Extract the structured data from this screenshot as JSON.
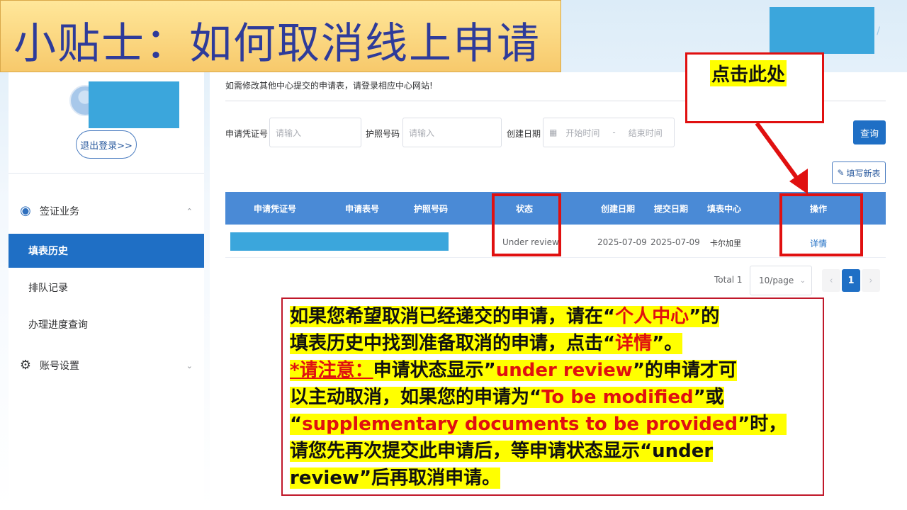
{
  "title": "小贴士：如何取消线上申请",
  "sidebar": {
    "logout_label": "退出登录>>",
    "groups": [
      {
        "label": "签证业务",
        "icon": "globe-icon",
        "expanded": true
      },
      {
        "label": "账号设置",
        "icon": "gear-icon",
        "expanded": false
      }
    ],
    "items": [
      {
        "label": "填表历史",
        "active": true
      },
      {
        "label": "排队记录",
        "active": false
      },
      {
        "label": "办理进度查询",
        "active": false
      }
    ]
  },
  "main": {
    "notice": "如需修改其他中心提交的申请表，请登录相应中心网站!",
    "filters": {
      "voucher_label": "申请凭证号",
      "voucher_placeholder": "请输入",
      "passport_label": "护照号码",
      "passport_placeholder": "请输入",
      "date_label": "创建日期",
      "start_placeholder": "开始时间",
      "date_sep": "-",
      "end_placeholder": "结束时间"
    },
    "query_label": "查询",
    "new_form_label": "填写新表",
    "table": {
      "columns": [
        "申请凭证号",
        "申请表号",
        "护照号码",
        "状态",
        "创建日期",
        "提交日期",
        "填表中心",
        "操作"
      ],
      "rows": [
        {
          "status": "Under review",
          "created": "2025-07-09",
          "submitted": "2025-07-09",
          "center": "卡尔加里",
          "action": "详情"
        }
      ]
    },
    "pager": {
      "total": "Total 1",
      "page_size": "10/page",
      "prev": "‹",
      "current": "1",
      "next": "›"
    }
  },
  "callout": {
    "text": "点击此处"
  },
  "info": {
    "l1a": "如果您希望取消已经递交的申请，请在“",
    "l1b": "个人中心",
    "l1c": "”的",
    "l2a": "填表历史中找到准备取消的申请，点击“",
    "l2b": "详情",
    "l2c": "”。",
    "l3a": "*请注意：",
    "l3b": "申请状态显示”",
    "l3c": "under review",
    "l3d": "”的申请才可",
    "l4a": "以主动取消，如果您的申请为“",
    "l4b": "To be modified",
    "l4c": "”或",
    "l5a": " “",
    "l5b": "supplementary documents to be provided",
    "l5c": "”时，",
    "l6a": "请您先再次提交此申请后，等申请状态显示“",
    "l6b": "under",
    "l7a": "review",
    "l7b": "”后再取消申请。"
  },
  "colors": {
    "accent": "#1f6fc5",
    "annotation_red": "#e01010",
    "highlight": "#ffff00",
    "title_text": "#2e3b9a"
  }
}
